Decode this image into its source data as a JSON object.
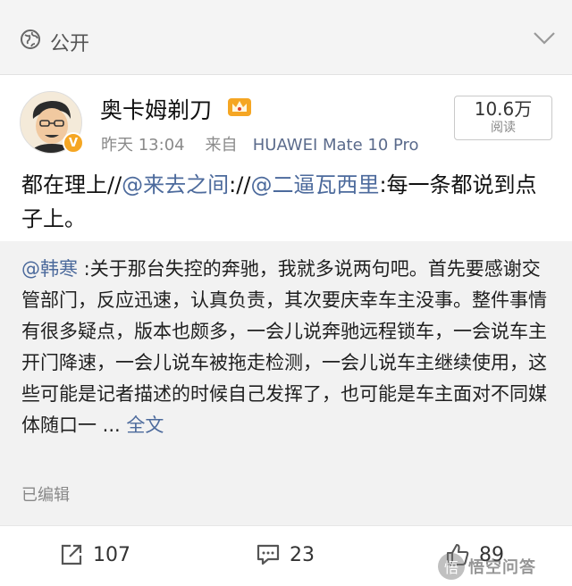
{
  "topbar": {
    "visibility_label": "公开"
  },
  "post": {
    "author": "奥卡姆剃刀",
    "verified_badge": "V",
    "time": "昨天 13:04",
    "source_prefix": "来自",
    "device": "HUAWEI Mate 10 Pro",
    "views": {
      "count": "10.6万",
      "label": "阅读"
    },
    "text": {
      "p1": "都在理上//",
      "m1": "@来去之间",
      "p2": "://",
      "m2": "@二逼瓦西里",
      "p3": ":每一条都说到点子上。"
    }
  },
  "quote": {
    "author": "@韩寒",
    "text": " :关于那台失控的奔驰，我就多说两句吧。首先要感谢交管部门，反应迅速，认真负责，其次要庆幸车主没事。整件事情有很多疑点，版本也颇多，一会儿说奔驰远程锁车，一会说车主开门降速，一会儿说车被拖走检测，一会儿说车主继续使用，这些可能是记者描述的时候自己发挥了，也可能是车主面对不同媒体随口一 ... ",
    "full_text_link": "全文",
    "edited_label": "已编辑"
  },
  "actions": {
    "repost_count": "107",
    "comment_count": "23",
    "like_count": "89"
  },
  "watermark": {
    "text": "悟空问答"
  },
  "colors": {
    "link": "#4c6a9c",
    "badge": "#f5a623",
    "quote_bg": "#f2f2f2"
  }
}
